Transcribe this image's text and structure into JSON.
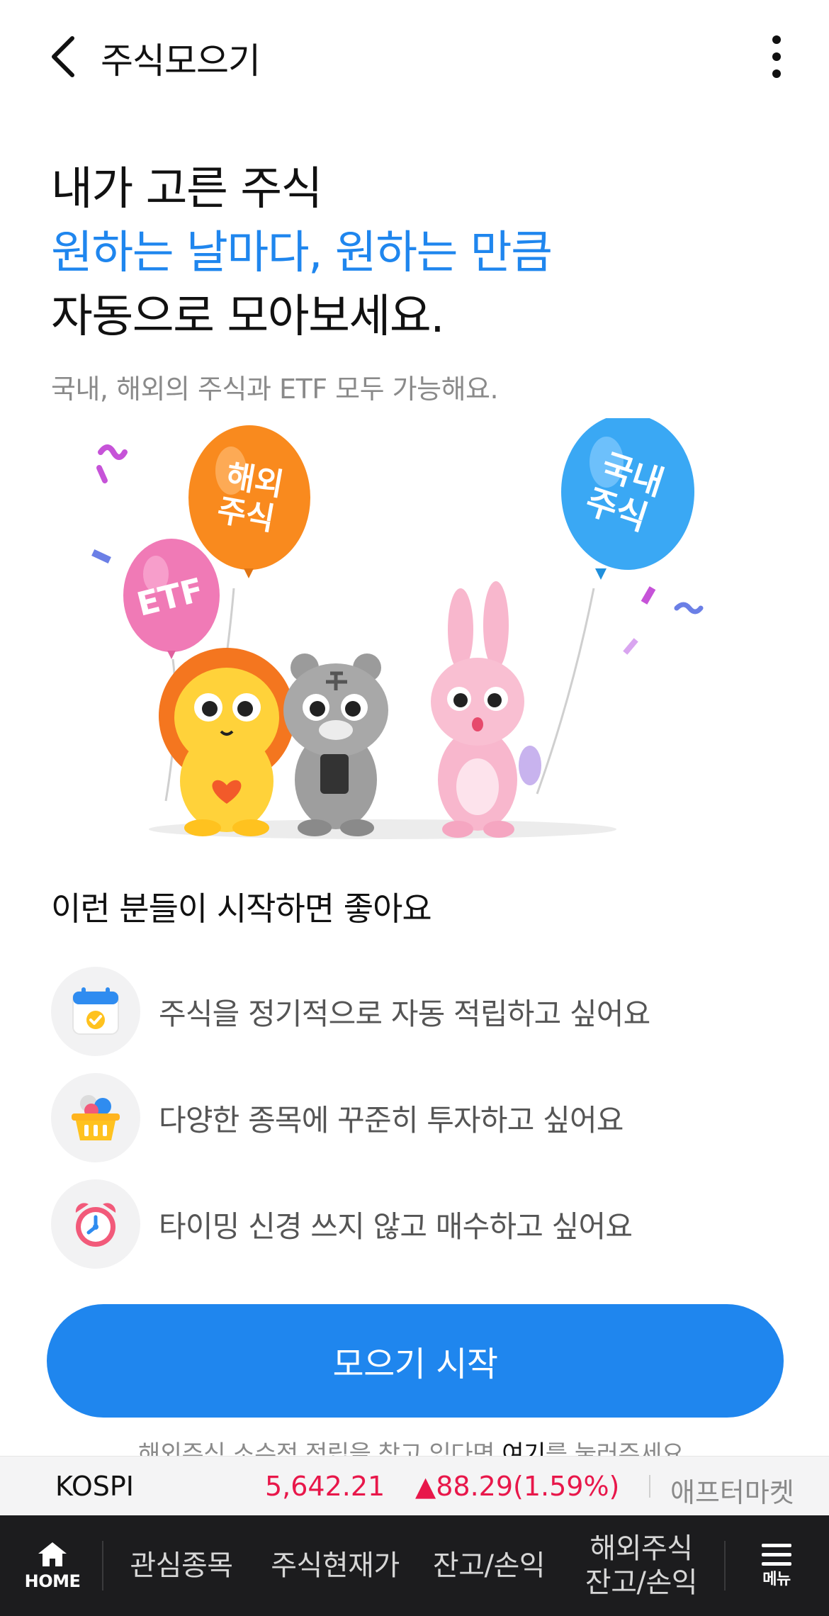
{
  "header": {
    "title": "주식모으기",
    "back_icon": "chevron-left-icon",
    "more_icon": "more-vertical-icon"
  },
  "hero": {
    "line1": "내가 고른 주식",
    "line2": "원하는 날마다, 원하는 만큼",
    "line3": "자동으로 모아보세요.",
    "subtitle": "국내, 해외의 주식과 ETF 모두 가능해요."
  },
  "illustration": {
    "balloon_etf": "ETF",
    "balloon_overseas_1": "해외",
    "balloon_overseas_2": "주식",
    "balloon_domestic_1": "국내",
    "balloon_domestic_2": "주식",
    "colors": {
      "etf": "#f07ab6",
      "overseas": "#f98a1e",
      "domestic": "#3aa8f4"
    }
  },
  "section": {
    "title": "이런 분들이 시작하면 좋아요",
    "items": [
      {
        "icon": "calendar-check-icon",
        "text": "주식을 정기적으로 자동 적립하고 싶어요"
      },
      {
        "icon": "shopping-basket-icon",
        "text": "다양한 종목에 꾸준히 투자하고 싶어요"
      },
      {
        "icon": "alarm-clock-icon",
        "text": "타이밍 신경 쓰지 않고 매수하고 싶어요"
      }
    ]
  },
  "cta": {
    "label": "모으기 시작"
  },
  "notice": {
    "prefix": "해외주식 소수점 적립을 찾고 있다면 ",
    "link": "여기",
    "suffix": "를 눌러주세요."
  },
  "ticker": {
    "name": "KOSPI",
    "price": "5,642.21",
    "change": "▲88.29(1.59%)",
    "market": "애프터마켓"
  },
  "nav": {
    "home_label": "HOME",
    "item1": "관심종목",
    "item2": "주식현재가",
    "item3": "잔고/손익",
    "item4_line1": "해외주식",
    "item4_line2": "잔고/손익",
    "menu_label": "메뉴"
  },
  "colors": {
    "accent": "#1f86ee",
    "up": "#e8174a",
    "nav_bg": "#1c1c1e"
  }
}
